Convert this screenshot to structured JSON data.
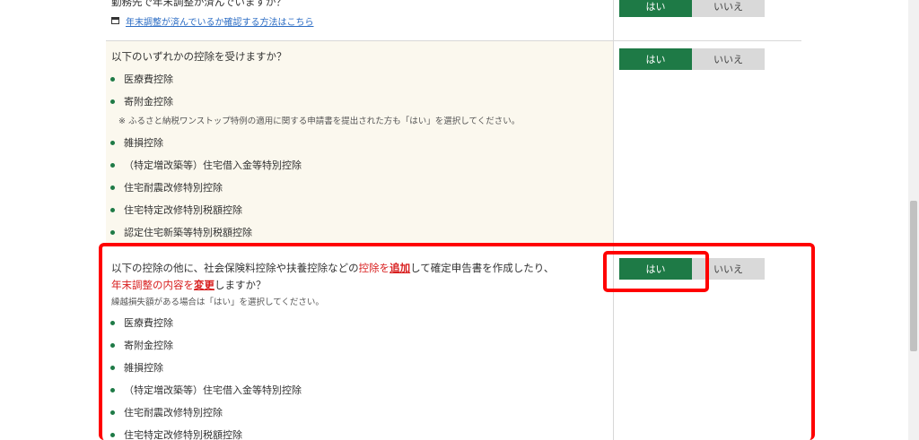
{
  "row1": {
    "question_partial": "勤務先で年末調整が済んでいますか？",
    "link_text": "年末調整が済んでいるか確認する方法はこちら",
    "yes_label": "はい",
    "no_label": "いいえ"
  },
  "row2": {
    "question": "以下のいずれかの控除を受けますか？",
    "items": [
      "医療費控除",
      "寄附金控除"
    ],
    "note": "※ ふるさと納税ワンストップ特例の適用に関する申請書を提出された方も「はい」を選択してください。",
    "items_after": [
      "雑損控除",
      "（特定増改築等）住宅借入金等特別控除",
      "住宅耐震改修特別控除",
      "住宅特定改修特別税額控除",
      "認定住宅新築等特別税額控除"
    ],
    "yes_label": "はい",
    "no_label": "いいえ"
  },
  "row3": {
    "q_part1": "以下の控除の他に、社会保険料控除や扶養控除などの",
    "q_red1": "控除を",
    "q_bold1": "追加",
    "q_part2": "して確定申告書を作成したり、",
    "q_red2": "年末調整の内容を",
    "q_bold2": "変更",
    "q_part3": "しますか？",
    "note": "繰越損失額がある場合は「はい」を選択してください。",
    "items": [
      "医療費控除",
      "寄附金控除",
      "雑損控除",
      "（特定増改築等）住宅借入金等特別控除",
      "住宅耐震改修特別控除",
      "住宅特定改修特別税額控除"
    ],
    "yes_label": "はい",
    "no_label": "いいえ"
  },
  "colors": {
    "accent_green": "#1e7a46",
    "highlight_red": "#ff0000",
    "link_blue": "#2b6cc4"
  }
}
